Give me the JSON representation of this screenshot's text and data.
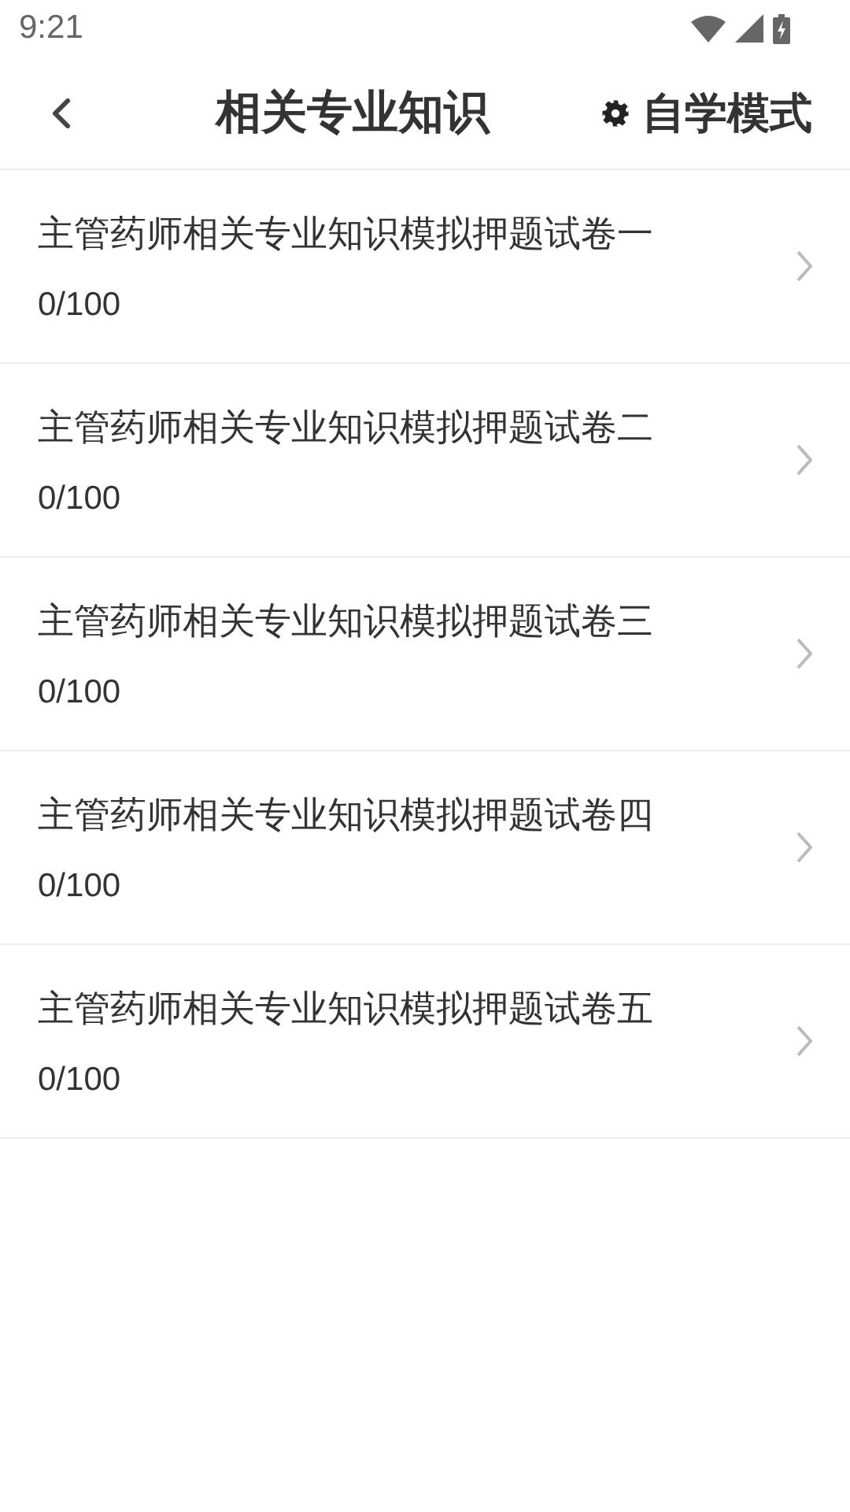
{
  "status_bar": {
    "time": "9:21"
  },
  "header": {
    "title": "相关专业知识",
    "action": "自学模式"
  },
  "papers": [
    {
      "title": "主管药师相关专业知识模拟押题试卷一",
      "progress": "0/100"
    },
    {
      "title": "主管药师相关专业知识模拟押题试卷二",
      "progress": "0/100"
    },
    {
      "title": "主管药师相关专业知识模拟押题试卷三",
      "progress": "0/100"
    },
    {
      "title": "主管药师相关专业知识模拟押题试卷四",
      "progress": "0/100"
    },
    {
      "title": "主管药师相关专业知识模拟押题试卷五",
      "progress": "0/100"
    }
  ]
}
